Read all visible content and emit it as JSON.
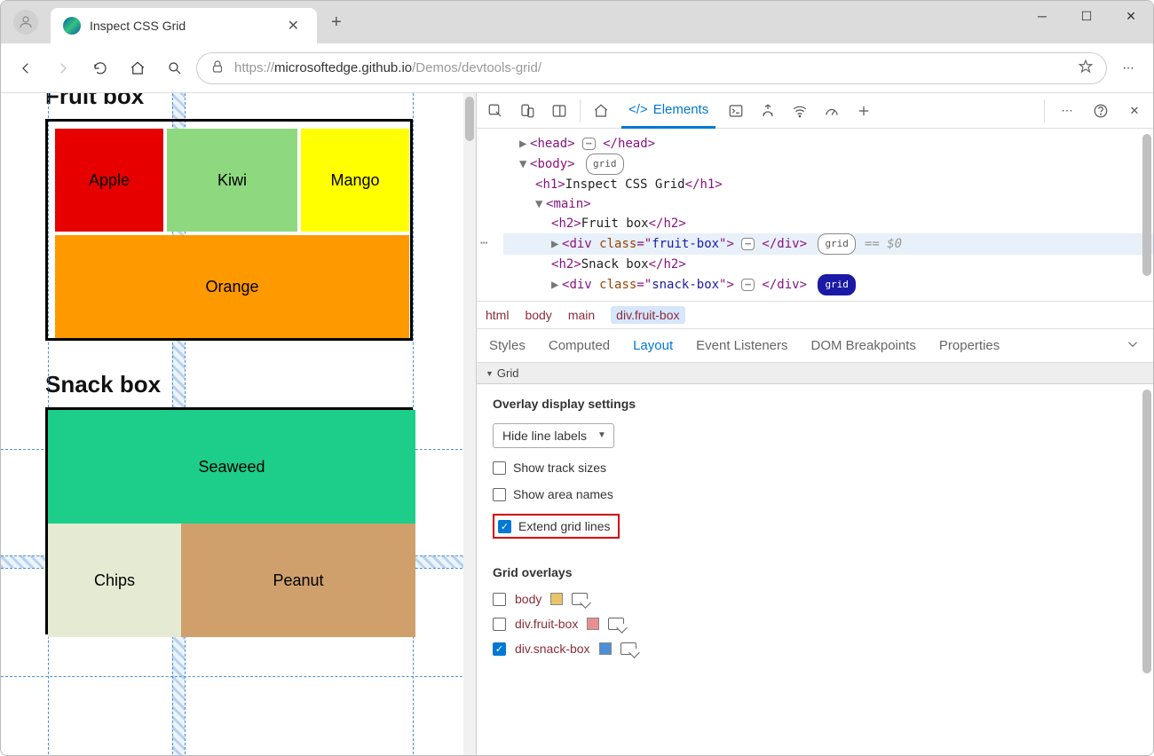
{
  "window": {
    "tab_title": "Inspect CSS Grid",
    "url_prefix": "https://",
    "url_host": "microsoftedge.github.io",
    "url_path": "/Demos/devtools-grid/"
  },
  "page": {
    "fruit_heading": "Fruit box",
    "snack_heading": "Snack box",
    "fruits": {
      "apple": "Apple",
      "kiwi": "Kiwi",
      "mango": "Mango",
      "orange": "Orange"
    },
    "snacks": {
      "seaweed": "Seaweed",
      "chips": "Chips",
      "peanut": "Peanut"
    }
  },
  "devtools": {
    "elements_tab": "Elements",
    "dom": {
      "head": "head",
      "body": "body",
      "grid_badge": "grid",
      "h1_text": "Inspect CSS Grid",
      "main": "main",
      "h2_fruit": "Fruit box",
      "div": "div",
      "class_attr": "class",
      "fruitbox_val": "fruit-box",
      "h2_snack": "Snack box",
      "snackbox_val": "snack-box",
      "eq0": "== $0"
    },
    "crumbs": [
      "html",
      "body",
      "main",
      "div.fruit-box"
    ],
    "panel_tabs": [
      "Styles",
      "Computed",
      "Layout",
      "Event Listeners",
      "DOM Breakpoints",
      "Properties"
    ],
    "grid_section": "Grid",
    "overlay_settings_title": "Overlay display settings",
    "line_labels_select": "Hide line labels",
    "show_track_sizes": "Show track sizes",
    "show_area_names": "Show area names",
    "extend_grid_lines": "Extend grid lines",
    "grid_overlays_title": "Grid overlays",
    "overlays": [
      {
        "label": "body",
        "checked": false,
        "swatch": "sw-body"
      },
      {
        "label": "div.fruit-box",
        "checked": false,
        "swatch": "sw-fruit"
      },
      {
        "label": "div.snack-box",
        "checked": true,
        "swatch": "sw-snack"
      }
    ]
  }
}
